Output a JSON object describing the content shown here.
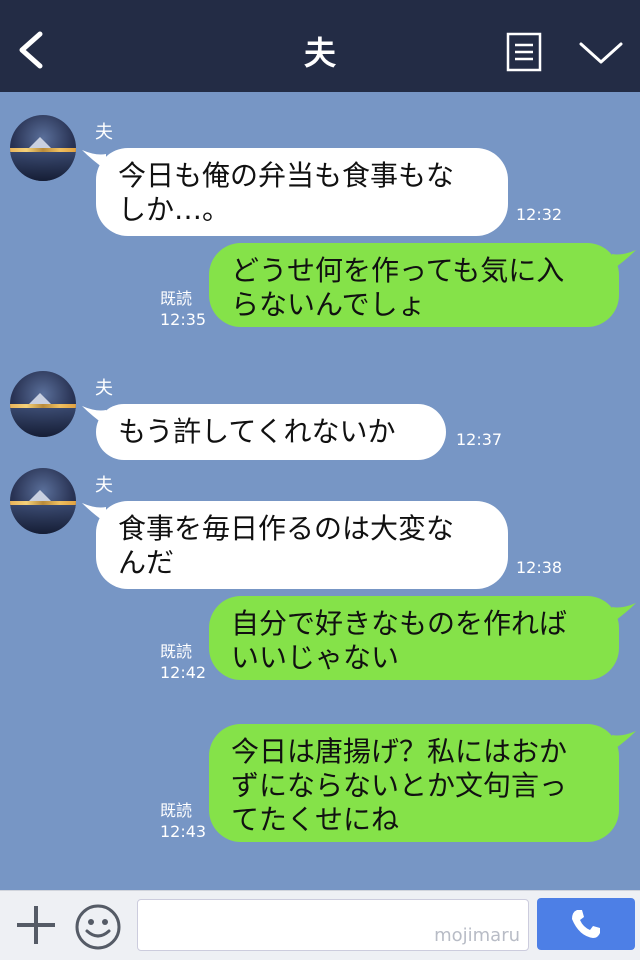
{
  "header": {
    "title": "夫"
  },
  "messages": [
    {
      "sender": "夫",
      "text": "今日も俺の弁当も食事もな\nしか…。",
      "time": "12:32"
    },
    {
      "text": "どうせ何を作っても気に入\nらないんでしょ",
      "read": "既読",
      "time": "12:35"
    },
    {
      "sender": "夫",
      "text": "もう許してくれないか",
      "time": "12:37"
    },
    {
      "sender": "夫",
      "text": "食事を毎日作るのは大変な\nんだ",
      "time": "12:38"
    },
    {
      "text": "自分で好きなものを作れば\nいいじゃない",
      "read": "既読",
      "time": "12:42"
    },
    {
      "text": "今日は唐揚げ？私にはおか\nずにならないとか文句言っ\nてたくせにね",
      "read": "既読",
      "time": "12:43"
    }
  ],
  "input": {
    "watermark": "mojimaru"
  },
  "colors": {
    "background": "#7796c5",
    "header": "#232c45",
    "own_bubble": "#85e249",
    "other_bubble": "#ffffff",
    "call_button": "#4d7fe6"
  }
}
